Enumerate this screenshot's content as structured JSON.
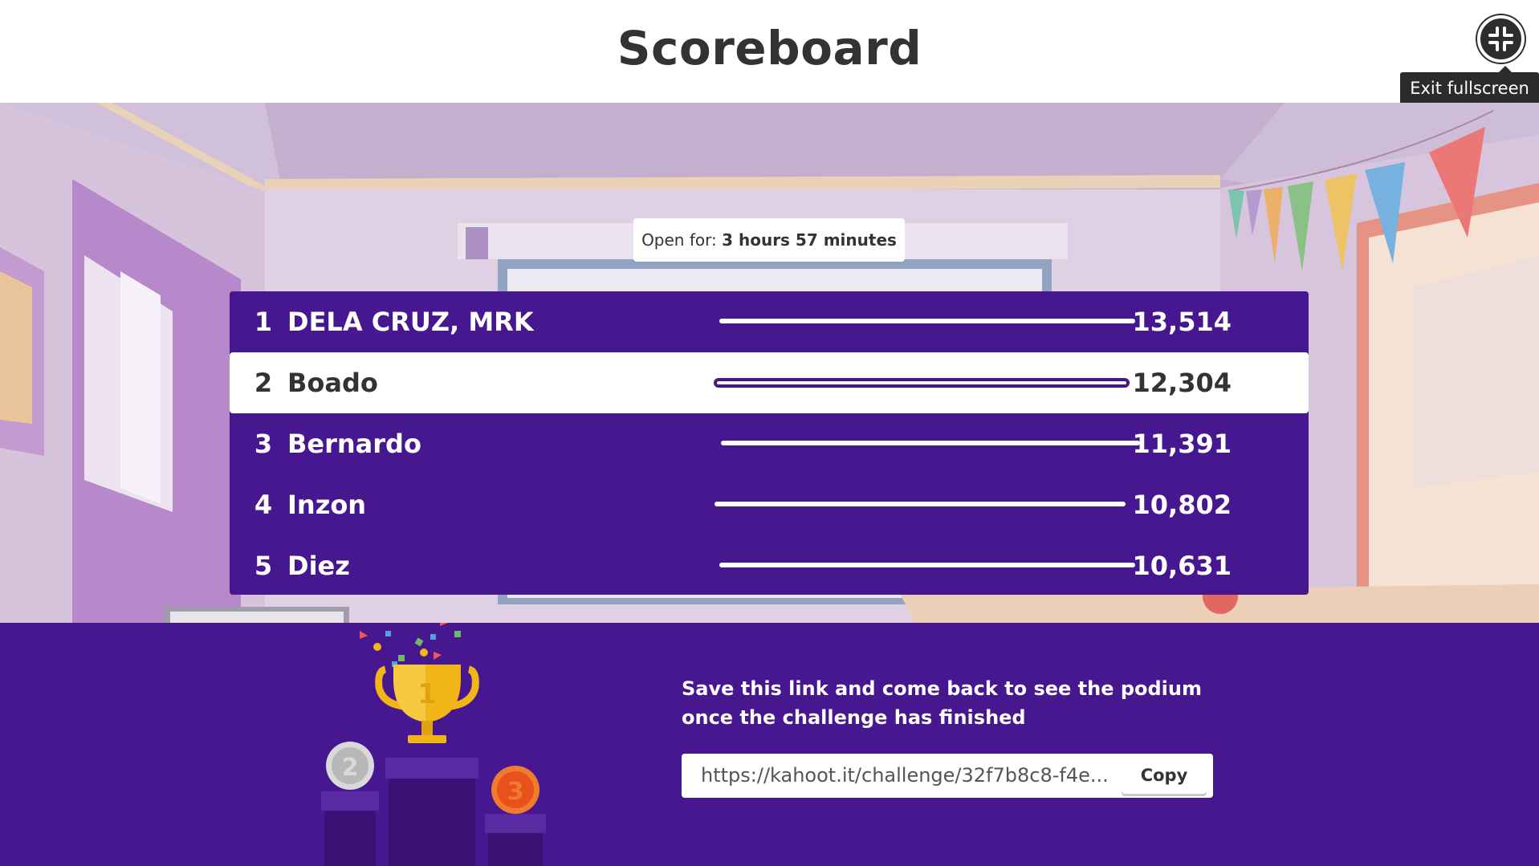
{
  "header": {
    "title": "Scoreboard",
    "exit_fullscreen_tooltip": "Exit fullscreen",
    "exit_fullscreen_icon": "compress-icon"
  },
  "timer": {
    "label": "Open for:",
    "value": "3 hours 57 minutes"
  },
  "scoreboard": {
    "rows": [
      {
        "rank": "1",
        "name": "DELA CRUZ, MRK",
        "score": "13,514",
        "highlighted": false
      },
      {
        "rank": "2",
        "name": "Boado",
        "score": "12,304",
        "highlighted": true
      },
      {
        "rank": "3",
        "name": "Bernardo",
        "score": "11,391",
        "highlighted": false
      },
      {
        "rank": "4",
        "name": "Inzon",
        "score": "10,802",
        "highlighted": false
      },
      {
        "rank": "5",
        "name": "Diez",
        "score": "10,631",
        "highlighted": false
      }
    ]
  },
  "footer": {
    "save_message_line1": "Save this link and come back to see the podium",
    "save_message_line2": "once the challenge has finished",
    "link_value": "https://kahoot.it/challenge/32f7b8c8-f4e...",
    "copy_label": "Copy",
    "podium_icon": "trophy-podium-icon",
    "podium_places": [
      "1",
      "2",
      "3"
    ]
  },
  "colors": {
    "brand_purple": "#46178f",
    "header_bg": "#ffffff",
    "gold": "#f2b517",
    "silver": "#b8b8b8",
    "bronze": "#e8501c"
  }
}
